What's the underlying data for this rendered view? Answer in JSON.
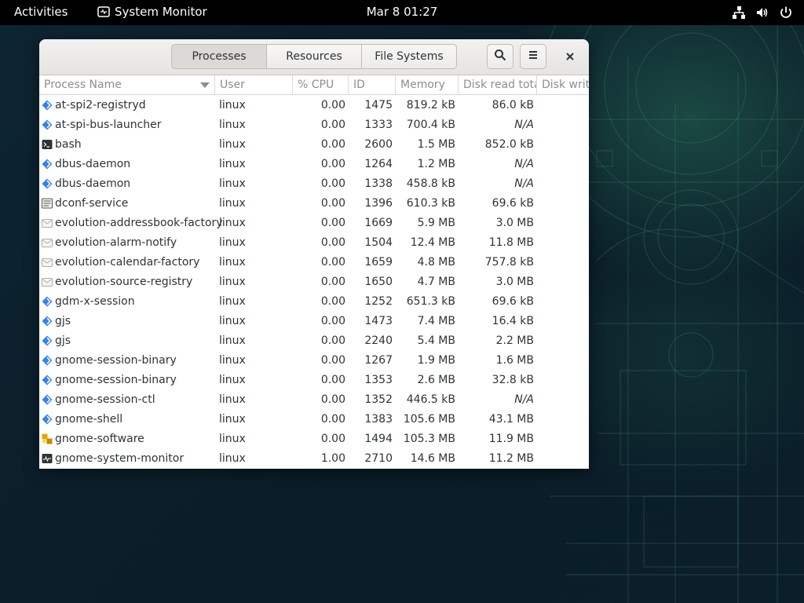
{
  "topbar": {
    "activities": "Activities",
    "app_name": "System Monitor",
    "clock": "Mar 8  01:27"
  },
  "window": {
    "tabs": [
      {
        "label": "Processes",
        "active": true
      },
      {
        "label": "Resources",
        "active": false
      },
      {
        "label": "File Systems",
        "active": false
      }
    ]
  },
  "columns": {
    "name": "Process Name",
    "user": "User",
    "cpu": "% CPU",
    "id": "ID",
    "memory": "Memory",
    "disk_read": "Disk read total",
    "disk_write": "Disk write"
  },
  "rows": [
    {
      "icon": "diamond",
      "name": "at-spi2-registryd",
      "user": "linux",
      "cpu": "0.00",
      "id": "1475",
      "memory": "819.2 kB",
      "disk_read": "86.0 kB"
    },
    {
      "icon": "diamond",
      "name": "at-spi-bus-launcher",
      "user": "linux",
      "cpu": "0.00",
      "id": "1333",
      "memory": "700.4 kB",
      "disk_read": "N/A"
    },
    {
      "icon": "terminal",
      "name": "bash",
      "user": "linux",
      "cpu": "0.00",
      "id": "2600",
      "memory": "1.5 MB",
      "disk_read": "852.0 kB"
    },
    {
      "icon": "diamond",
      "name": "dbus-daemon",
      "user": "linux",
      "cpu": "0.00",
      "id": "1264",
      "memory": "1.2 MB",
      "disk_read": "N/A"
    },
    {
      "icon": "diamond",
      "name": "dbus-daemon",
      "user": "linux",
      "cpu": "0.00",
      "id": "1338",
      "memory": "458.8 kB",
      "disk_read": "N/A"
    },
    {
      "icon": "dconf",
      "name": "dconf-service",
      "user": "linux",
      "cpu": "0.00",
      "id": "1396",
      "memory": "610.3 kB",
      "disk_read": "69.6 kB"
    },
    {
      "icon": "mail",
      "name": "evolution-addressbook-factory",
      "user": "linux",
      "cpu": "0.00",
      "id": "1669",
      "memory": "5.9 MB",
      "disk_read": "3.0 MB"
    },
    {
      "icon": "mail",
      "name": "evolution-alarm-notify",
      "user": "linux",
      "cpu": "0.00",
      "id": "1504",
      "memory": "12.4 MB",
      "disk_read": "11.8 MB"
    },
    {
      "icon": "mail",
      "name": "evolution-calendar-factory",
      "user": "linux",
      "cpu": "0.00",
      "id": "1659",
      "memory": "4.8 MB",
      "disk_read": "757.8 kB"
    },
    {
      "icon": "mail",
      "name": "evolution-source-registry",
      "user": "linux",
      "cpu": "0.00",
      "id": "1650",
      "memory": "4.7 MB",
      "disk_read": "3.0 MB"
    },
    {
      "icon": "diamond",
      "name": "gdm-x-session",
      "user": "linux",
      "cpu": "0.00",
      "id": "1252",
      "memory": "651.3 kB",
      "disk_read": "69.6 kB"
    },
    {
      "icon": "diamond",
      "name": "gjs",
      "user": "linux",
      "cpu": "0.00",
      "id": "1473",
      "memory": "7.4 MB",
      "disk_read": "16.4 kB"
    },
    {
      "icon": "diamond",
      "name": "gjs",
      "user": "linux",
      "cpu": "0.00",
      "id": "2240",
      "memory": "5.4 MB",
      "disk_read": "2.2 MB"
    },
    {
      "icon": "diamond",
      "name": "gnome-session-binary",
      "user": "linux",
      "cpu": "0.00",
      "id": "1267",
      "memory": "1.9 MB",
      "disk_read": "1.6 MB"
    },
    {
      "icon": "diamond",
      "name": "gnome-session-binary",
      "user": "linux",
      "cpu": "0.00",
      "id": "1353",
      "memory": "2.6 MB",
      "disk_read": "32.8 kB"
    },
    {
      "icon": "diamond",
      "name": "gnome-session-ctl",
      "user": "linux",
      "cpu": "0.00",
      "id": "1352",
      "memory": "446.5 kB",
      "disk_read": "N/A"
    },
    {
      "icon": "diamond",
      "name": "gnome-shell",
      "user": "linux",
      "cpu": "0.00",
      "id": "1383",
      "memory": "105.6 MB",
      "disk_read": "43.1 MB"
    },
    {
      "icon": "software",
      "name": "gnome-software",
      "user": "linux",
      "cpu": "0.00",
      "id": "1494",
      "memory": "105.3 MB",
      "disk_read": "11.9 MB"
    },
    {
      "icon": "sysmon",
      "name": "gnome-system-monitor",
      "user": "linux",
      "cpu": "1.00",
      "id": "2710",
      "memory": "14.6 MB",
      "disk_read": "11.2 MB"
    }
  ]
}
